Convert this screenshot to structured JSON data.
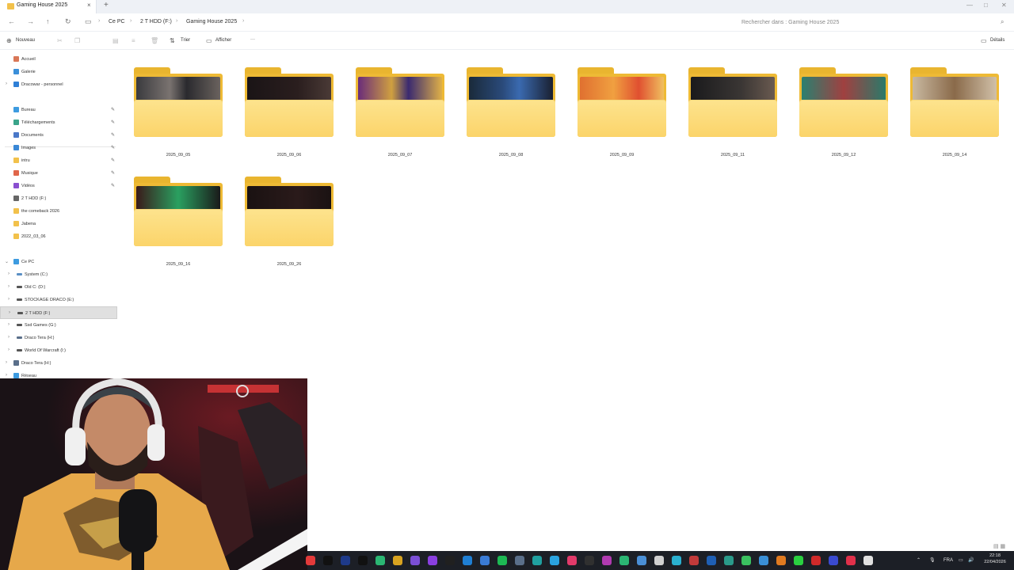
{
  "window": {
    "tab_title": "Gaming House 2025",
    "new_tab": "+",
    "close": "×",
    "minimize": "—",
    "maximize": "□",
    "close_window": "✕"
  },
  "address": {
    "crumbs": [
      "Ce PC",
      "2 T HDD (F:)",
      "Gaming House 2025"
    ],
    "search_placeholder": "Rechercher dans : Gaming House 2025"
  },
  "toolbar": {
    "new_label": "Nouveau",
    "sort_label": "Trier",
    "view_label": "Afficher",
    "more_label": "···",
    "details_label": "Détails"
  },
  "sidebar": {
    "top": [
      {
        "label": "Accueil",
        "icon": "home-icon",
        "color": "#d97757"
      },
      {
        "label": "Galerie",
        "icon": "gallery-icon",
        "color": "#3a8fd9"
      },
      {
        "label": "Dracowar - personnel",
        "icon": "cloud-icon",
        "color": "#2f7fd6"
      }
    ],
    "quick": [
      {
        "label": "Bureau",
        "icon": "desktop-icon",
        "color": "#3d9be0"
      },
      {
        "label": "Téléchargements",
        "icon": "download-icon",
        "color": "#3aa48a"
      },
      {
        "label": "Documents",
        "icon": "documents-icon",
        "color": "#4a78c8"
      },
      {
        "label": "Images",
        "icon": "images-icon",
        "color": "#3a88d6"
      },
      {
        "label": "intru",
        "icon": "folder-icon",
        "color": "#f2c14b"
      },
      {
        "label": "Musique",
        "icon": "music-icon",
        "color": "#e0664a"
      },
      {
        "label": "Vidéos",
        "icon": "videos-icon",
        "color": "#8a4fd0"
      },
      {
        "label": "2 T HDD (F:)",
        "icon": "drive-icon",
        "color": "#666666"
      },
      {
        "label": "the comeback 2026",
        "icon": "folder-icon",
        "color": "#f2c14b"
      },
      {
        "label": "Jabena",
        "icon": "folder-icon",
        "color": "#f2c14b"
      },
      {
        "label": "2022_03_06",
        "icon": "folder-icon",
        "color": "#f2c14b"
      }
    ],
    "pc": {
      "label": "Ce PC",
      "icon": "pc-icon",
      "color": "#3d9be0"
    },
    "drives": [
      {
        "label": "System (C:)",
        "icon": "drive-icon",
        "color": "#5a8fc4"
      },
      {
        "label": "Old C: (D:)",
        "icon": "drive-icon",
        "color": "#555555"
      },
      {
        "label": "STOCKAGE DRACO (E:)",
        "icon": "drive-icon",
        "color": "#555555"
      },
      {
        "label": "2 T HDD (F:)",
        "icon": "drive-icon",
        "color": "#555555"
      },
      {
        "label": "Ssd Games (G:)",
        "icon": "drive-icon",
        "color": "#555555"
      },
      {
        "label": "Draco Tera (H:)",
        "icon": "drive-icon",
        "color": "#5a6f8a"
      },
      {
        "label": "World Of Warcraft (I:)",
        "icon": "drive-icon",
        "color": "#555555"
      }
    ],
    "bottom": [
      {
        "label": "Draco Tera (H:)",
        "icon": "drive-icon",
        "color": "#5a6f8a"
      },
      {
        "label": "Réseau",
        "icon": "network-icon",
        "color": "#3d9be0"
      }
    ]
  },
  "folders": [
    {
      "name": "2025_09_05",
      "thumb": "linear-gradient(90deg,#3a3a3e,#7a7370 40%,#2a2a2e 60%,#6a625e)"
    },
    {
      "name": "2025_09_06",
      "thumb": "linear-gradient(90deg,#1a1416,#2a1e1e 60%,#4a3a36)"
    },
    {
      "name": "2025_09_07",
      "thumb": "linear-gradient(90deg,#6a2c7a,#d0a040 40%,#3a2a70 60%,#e0b048)"
    },
    {
      "name": "2025_09_08",
      "thumb": "linear-gradient(90deg,#1a2a3a,#2a4a7a 40%,#3a6ab0 60%,#1a2030)"
    },
    {
      "name": "2025_09_09",
      "thumb": "linear-gradient(90deg,#e07030,#f0a040 40%,#e05030 70%,#f0c060)"
    },
    {
      "name": "2025_09_11",
      "thumb": "linear-gradient(90deg,#1a1a1c,#3a3634 60%,#6a5a50)"
    },
    {
      "name": "2025_09_12",
      "thumb": "linear-gradient(90deg,#2a8070,#a04040 50%,#2a7a6a)"
    },
    {
      "name": "2025_09_14",
      "thumb": "linear-gradient(90deg,#c8b8a0,#8a6a4a 50%,#d0c0a8)"
    },
    {
      "name": "2025_09_16",
      "thumb": "linear-gradient(90deg,#3a1a1a,#2aa060 50%,#1a1a1a)"
    },
    {
      "name": "2025_09_26",
      "thumb": "linear-gradient(90deg,#1a1212,#2a1a1a 60%,#1a1212)"
    }
  ],
  "taskbar": {
    "icons": [
      {
        "name": "app-red-icon",
        "color": "#e23a3a"
      },
      {
        "name": "capcut-icon",
        "color": "#111111"
      },
      {
        "name": "lc-icon",
        "color": "#1e3a8a"
      },
      {
        "name": "tiktok-icon",
        "color": "#111111"
      },
      {
        "name": "app-green-icon",
        "color": "#2bb673"
      },
      {
        "name": "chrome-icon",
        "color": "#d8a320"
      },
      {
        "name": "app-purple-icon",
        "color": "#7b4fd6"
      },
      {
        "name": "app-violet-icon",
        "color": "#8a3fe0"
      },
      {
        "name": "obs-icon",
        "color": "#202020"
      },
      {
        "name": "edge-icon",
        "color": "#1f7fd4"
      },
      {
        "name": "app-blue-icon",
        "color": "#3a7bd5"
      },
      {
        "name": "spotify-icon",
        "color": "#1db954"
      },
      {
        "name": "app-gray-icon",
        "color": "#5a6f8a"
      },
      {
        "name": "capcut-x-icon",
        "color": "#20a0a0"
      },
      {
        "name": "telegram-icon",
        "color": "#2aa3e0"
      },
      {
        "name": "app-pink-icon",
        "color": "#e23a6a"
      },
      {
        "name": "app-dark-icon",
        "color": "#303030"
      },
      {
        "name": "app-magenta-icon",
        "color": "#b03ab0"
      },
      {
        "name": "app-green2-icon",
        "color": "#2bb673"
      },
      {
        "name": "app-multi-icon",
        "color": "#4a8fd6"
      },
      {
        "name": "app-white-icon",
        "color": "#d0d0d0"
      },
      {
        "name": "app-cyan-icon",
        "color": "#2ab0d0"
      },
      {
        "name": "app-red2-icon",
        "color": "#c23a3a"
      },
      {
        "name": "app-blue2-icon",
        "color": "#1f5fb4"
      },
      {
        "name": "app-teal-icon",
        "color": "#2a9a8a"
      },
      {
        "name": "app-green3-icon",
        "color": "#3ac060"
      },
      {
        "name": "app-globe-icon",
        "color": "#3a8fd6"
      },
      {
        "name": "search-orange-icon",
        "color": "#e07a20"
      },
      {
        "name": "app-lime-icon",
        "color": "#2ad040"
      },
      {
        "name": "app-crimson-icon",
        "color": "#d02a2a"
      },
      {
        "name": "app-indigo-icon",
        "color": "#3a4ad0"
      },
      {
        "name": "adobe-icon",
        "color": "#e0304a"
      },
      {
        "name": "app-white2-icon",
        "color": "#e0e0e0"
      }
    ],
    "lang": "FRA",
    "time": "22:18",
    "date": "22/04/2026"
  }
}
